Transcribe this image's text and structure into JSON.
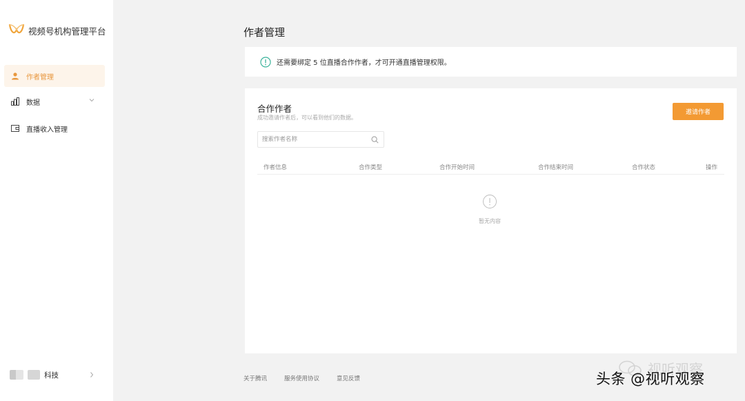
{
  "sidebar": {
    "brand_name": "视频号机构管理平台",
    "nav": [
      {
        "label": "作者管理",
        "icon": "user-icon",
        "active": true
      },
      {
        "label": "数据",
        "icon": "bar-chart-icon",
        "active": false
      },
      {
        "label": "直播收入管理",
        "icon": "wallet-icon",
        "active": false
      }
    ],
    "org_name": "科技"
  },
  "main": {
    "title": "作者管理",
    "notice": {
      "text": "还需要绑定 5 位直播合作作者，才可开通直播管理权限。",
      "icon": "info-circle-icon"
    },
    "partners": {
      "title": "合作作者",
      "subtitle": "成功邀请作者后，可以看到他们的数据。",
      "add_button": "邀请作者",
      "search_placeholder": "搜索作者名称",
      "columns": [
        "作者信息",
        "合作类型",
        "合作开始时间",
        "合作结束时间",
        "合作状态",
        "操作"
      ],
      "empty_text": "暂无内容"
    }
  },
  "footer": {
    "links": [
      "关于腾讯",
      "服务使用协议",
      "意见反馈"
    ]
  },
  "watermark": {
    "shadow_text": "视听观察",
    "text": "头条 @视听观察"
  },
  "colors": {
    "accent": "#f39a33",
    "active_bg": "#fdf4ea",
    "active_text": "#e8973e",
    "notice_icon": "#3bb39b"
  }
}
